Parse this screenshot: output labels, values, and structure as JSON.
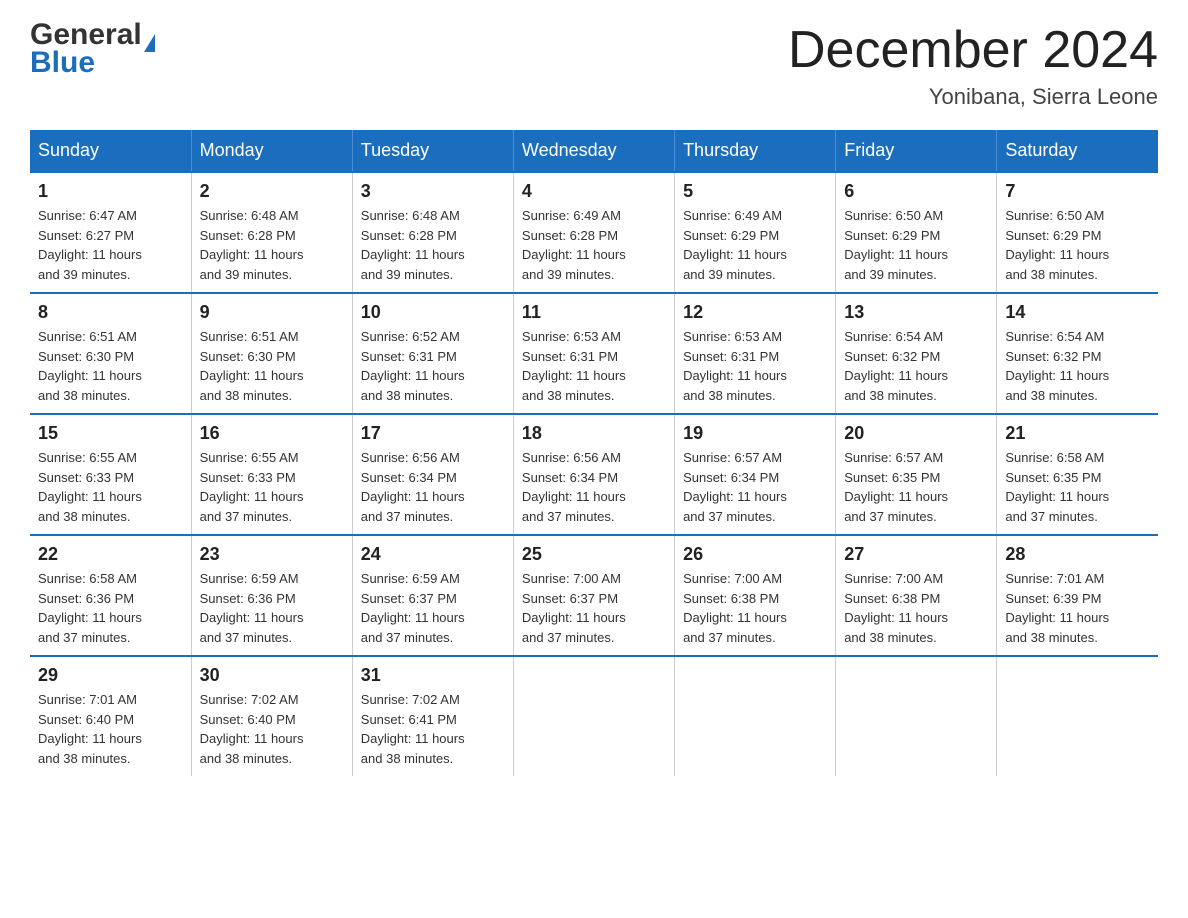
{
  "header": {
    "logo_general": "General",
    "logo_blue": "Blue",
    "month_title": "December 2024",
    "location": "Yonibana, Sierra Leone"
  },
  "days_of_week": [
    "Sunday",
    "Monday",
    "Tuesday",
    "Wednesday",
    "Thursday",
    "Friday",
    "Saturday"
  ],
  "weeks": [
    [
      {
        "day": "1",
        "sunrise": "6:47 AM",
        "sunset": "6:27 PM",
        "daylight": "11 hours and 39 minutes."
      },
      {
        "day": "2",
        "sunrise": "6:48 AM",
        "sunset": "6:28 PM",
        "daylight": "11 hours and 39 minutes."
      },
      {
        "day": "3",
        "sunrise": "6:48 AM",
        "sunset": "6:28 PM",
        "daylight": "11 hours and 39 minutes."
      },
      {
        "day": "4",
        "sunrise": "6:49 AM",
        "sunset": "6:28 PM",
        "daylight": "11 hours and 39 minutes."
      },
      {
        "day": "5",
        "sunrise": "6:49 AM",
        "sunset": "6:29 PM",
        "daylight": "11 hours and 39 minutes."
      },
      {
        "day": "6",
        "sunrise": "6:50 AM",
        "sunset": "6:29 PM",
        "daylight": "11 hours and 39 minutes."
      },
      {
        "day": "7",
        "sunrise": "6:50 AM",
        "sunset": "6:29 PM",
        "daylight": "11 hours and 38 minutes."
      }
    ],
    [
      {
        "day": "8",
        "sunrise": "6:51 AM",
        "sunset": "6:30 PM",
        "daylight": "11 hours and 38 minutes."
      },
      {
        "day": "9",
        "sunrise": "6:51 AM",
        "sunset": "6:30 PM",
        "daylight": "11 hours and 38 minutes."
      },
      {
        "day": "10",
        "sunrise": "6:52 AM",
        "sunset": "6:31 PM",
        "daylight": "11 hours and 38 minutes."
      },
      {
        "day": "11",
        "sunrise": "6:53 AM",
        "sunset": "6:31 PM",
        "daylight": "11 hours and 38 minutes."
      },
      {
        "day": "12",
        "sunrise": "6:53 AM",
        "sunset": "6:31 PM",
        "daylight": "11 hours and 38 minutes."
      },
      {
        "day": "13",
        "sunrise": "6:54 AM",
        "sunset": "6:32 PM",
        "daylight": "11 hours and 38 minutes."
      },
      {
        "day": "14",
        "sunrise": "6:54 AM",
        "sunset": "6:32 PM",
        "daylight": "11 hours and 38 minutes."
      }
    ],
    [
      {
        "day": "15",
        "sunrise": "6:55 AM",
        "sunset": "6:33 PM",
        "daylight": "11 hours and 38 minutes."
      },
      {
        "day": "16",
        "sunrise": "6:55 AM",
        "sunset": "6:33 PM",
        "daylight": "11 hours and 37 minutes."
      },
      {
        "day": "17",
        "sunrise": "6:56 AM",
        "sunset": "6:34 PM",
        "daylight": "11 hours and 37 minutes."
      },
      {
        "day": "18",
        "sunrise": "6:56 AM",
        "sunset": "6:34 PM",
        "daylight": "11 hours and 37 minutes."
      },
      {
        "day": "19",
        "sunrise": "6:57 AM",
        "sunset": "6:34 PM",
        "daylight": "11 hours and 37 minutes."
      },
      {
        "day": "20",
        "sunrise": "6:57 AM",
        "sunset": "6:35 PM",
        "daylight": "11 hours and 37 minutes."
      },
      {
        "day": "21",
        "sunrise": "6:58 AM",
        "sunset": "6:35 PM",
        "daylight": "11 hours and 37 minutes."
      }
    ],
    [
      {
        "day": "22",
        "sunrise": "6:58 AM",
        "sunset": "6:36 PM",
        "daylight": "11 hours and 37 minutes."
      },
      {
        "day": "23",
        "sunrise": "6:59 AM",
        "sunset": "6:36 PM",
        "daylight": "11 hours and 37 minutes."
      },
      {
        "day": "24",
        "sunrise": "6:59 AM",
        "sunset": "6:37 PM",
        "daylight": "11 hours and 37 minutes."
      },
      {
        "day": "25",
        "sunrise": "7:00 AM",
        "sunset": "6:37 PM",
        "daylight": "11 hours and 37 minutes."
      },
      {
        "day": "26",
        "sunrise": "7:00 AM",
        "sunset": "6:38 PM",
        "daylight": "11 hours and 37 minutes."
      },
      {
        "day": "27",
        "sunrise": "7:00 AM",
        "sunset": "6:38 PM",
        "daylight": "11 hours and 38 minutes."
      },
      {
        "day": "28",
        "sunrise": "7:01 AM",
        "sunset": "6:39 PM",
        "daylight": "11 hours and 38 minutes."
      }
    ],
    [
      {
        "day": "29",
        "sunrise": "7:01 AM",
        "sunset": "6:40 PM",
        "daylight": "11 hours and 38 minutes."
      },
      {
        "day": "30",
        "sunrise": "7:02 AM",
        "sunset": "6:40 PM",
        "daylight": "11 hours and 38 minutes."
      },
      {
        "day": "31",
        "sunrise": "7:02 AM",
        "sunset": "6:41 PM",
        "daylight": "11 hours and 38 minutes."
      },
      null,
      null,
      null,
      null
    ]
  ],
  "labels": {
    "sunrise": "Sunrise:",
    "sunset": "Sunset:",
    "daylight": "Daylight:"
  }
}
